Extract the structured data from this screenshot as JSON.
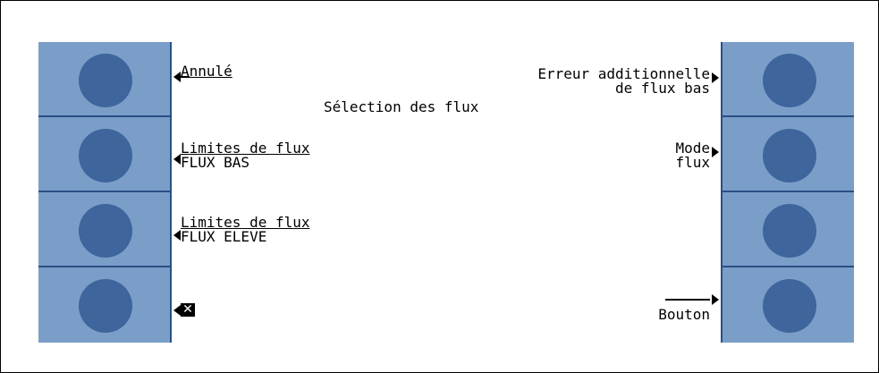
{
  "screen": {
    "title": "Sélection des flux",
    "left": [
      {
        "line1": "Annulé",
        "line2": ""
      },
      {
        "line1": "Limites de flux",
        "line2": "FLUX BAS"
      },
      {
        "line1": "Limites de flux",
        "line2": "FLUX ELEVE"
      },
      {
        "line1": "",
        "line2": "",
        "icon": "close-box-icon"
      }
    ],
    "right": [
      {
        "line1": "Erreur additionnelle",
        "line2": "de flux bas"
      },
      {
        "line1": "Mode",
        "line2": "flux"
      },
      {
        "line1": "",
        "line2": ""
      },
      {
        "line1": "Bouton",
        "line2": ""
      }
    ]
  },
  "colors": {
    "side_panel": "#7b9ec9",
    "button_circle": "#3e659c",
    "divider": "#2a4f86"
  }
}
